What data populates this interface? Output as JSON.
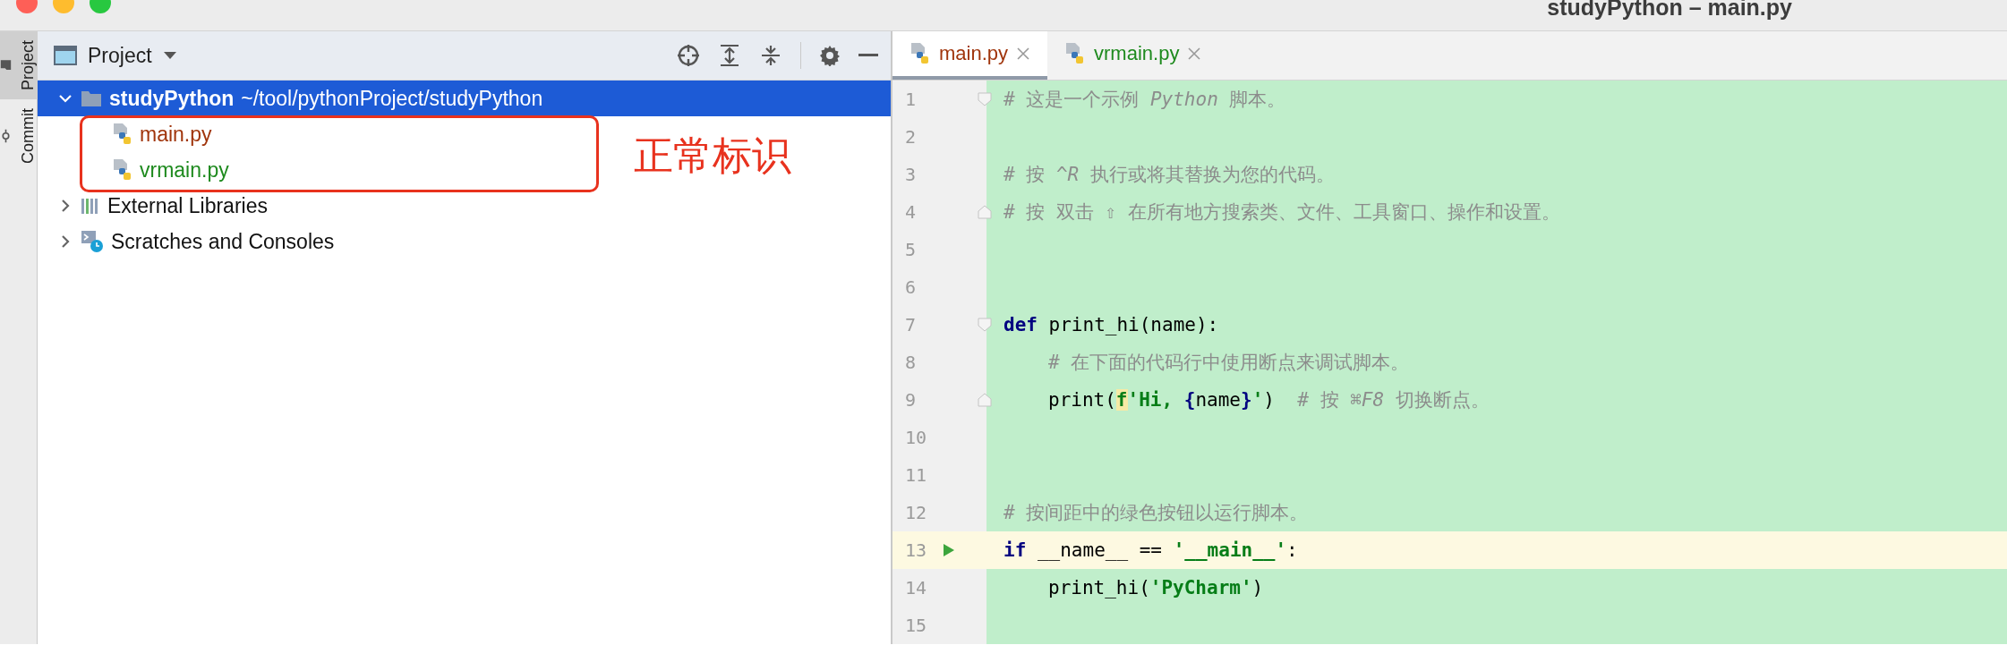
{
  "window": {
    "title": "studyPython – main.py"
  },
  "tool_strip": [
    {
      "label": "Project",
      "selected": true,
      "kind": "folder"
    },
    {
      "label": "Commit",
      "selected": false,
      "kind": "commit"
    }
  ],
  "project_panel": {
    "title": "Project",
    "tree": [
      {
        "name": "studyPython",
        "path": "~/tool/pythonProject/studyPython",
        "kind": "folder",
        "expanded": true,
        "selected": true,
        "children": [
          {
            "name": "main.py",
            "kind": "python",
            "color": "#a0350c",
            "selected": false
          },
          {
            "name": "vrmain.py",
            "kind": "python",
            "color": "#1e8a1e",
            "selected": false
          }
        ]
      },
      {
        "name": "External Libraries",
        "kind": "library",
        "expanded": false,
        "selected": false
      },
      {
        "name": "Scratches and Consoles",
        "kind": "scratch",
        "expanded": false,
        "selected": false
      }
    ],
    "annotation": {
      "label": "正常标识"
    }
  },
  "editor": {
    "tabs": [
      {
        "label": "main.py",
        "color": "#a0350c",
        "selected": true
      },
      {
        "label": "vrmain.py",
        "color": "#1e8a1e",
        "selected": false
      }
    ],
    "lines": [
      {
        "number": "1",
        "fold_open": true,
        "fold_close": false,
        "indented": false,
        "run": false,
        "current": false,
        "tokens": [
          {
            "kind": "comment",
            "text": "# 这是一个示例 "
          },
          {
            "kind": "comment-italic",
            "text": "Python"
          },
          {
            "kind": "comment",
            "text": " 脚本。"
          }
        ]
      },
      {
        "number": "2",
        "fold_open": false,
        "fold_close": false,
        "run": false,
        "current": false
      },
      {
        "number": "3",
        "fold_open": false,
        "fold_close": false,
        "indented": false,
        "run": false,
        "current": false,
        "tokens": [
          {
            "kind": "comment",
            "text": "# 按 "
          },
          {
            "kind": "comment-italic",
            "text": "^R"
          },
          {
            "kind": "comment",
            "text": " 执行或将其替换为您的代码。"
          }
        ]
      },
      {
        "number": "4",
        "fold_open": false,
        "fold_close": true,
        "indented": false,
        "run": false,
        "current": false,
        "tokens": [
          {
            "kind": "comment",
            "text": "# 按 双击 ⇧ 在所有地方搜索类、文件、工具窗口、操作和设置。"
          }
        ]
      },
      {
        "number": "5",
        "fold_open": false,
        "fold_close": false,
        "run": false,
        "current": false
      },
      {
        "number": "6",
        "fold_open": false,
        "fold_close": false,
        "run": false,
        "current": false
      },
      {
        "number": "7",
        "fold_open": true,
        "fold_close": false,
        "indented": false,
        "run": false,
        "current": false,
        "tokens": [
          {
            "kind": "keyword",
            "text": "def"
          },
          {
            "kind": "plain",
            "text": " print_hi(name):"
          }
        ]
      },
      {
        "number": "8",
        "fold_open": false,
        "fold_close": false,
        "indented": true,
        "run": false,
        "current": false,
        "tokens": [
          {
            "kind": "comment",
            "text": "# 在下面的代码行中使用断点来调试脚本。"
          }
        ]
      },
      {
        "number": "9",
        "fold_open": false,
        "fold_close": true,
        "indented": true,
        "run": false,
        "current": false,
        "tokens": [
          {
            "kind": "plain",
            "text": "print("
          },
          {
            "kind": "fprefix",
            "text": "f"
          },
          {
            "kind": "string",
            "text": "'Hi, "
          },
          {
            "kind": "brace",
            "text": "{"
          },
          {
            "kind": "plain",
            "text": "name"
          },
          {
            "kind": "brace",
            "text": "}"
          },
          {
            "kind": "string",
            "text": "'"
          },
          {
            "kind": "plain",
            "text": ")  "
          },
          {
            "kind": "comment",
            "text": "# 按 "
          },
          {
            "kind": "comment-italic",
            "text": "⌘F8"
          },
          {
            "kind": "comment",
            "text": " 切换断点。"
          }
        ]
      },
      {
        "number": "10",
        "fold_open": false,
        "fold_close": false,
        "run": false,
        "current": false
      },
      {
        "number": "11",
        "fold_open": false,
        "fold_close": false,
        "run": false,
        "current": false
      },
      {
        "number": "12",
        "fold_open": false,
        "fold_close": false,
        "indented": false,
        "run": false,
        "current": false,
        "tokens": [
          {
            "kind": "comment",
            "text": "# 按间距中的绿色按钮以运行脚本。"
          }
        ]
      },
      {
        "number": "13",
        "fold_open": false,
        "fold_close": false,
        "indented": false,
        "run": true,
        "current": true,
        "tokens": [
          {
            "kind": "keyword",
            "text": "if"
          },
          {
            "kind": "plain",
            "text": " __name__ == "
          },
          {
            "kind": "string",
            "text": "'__main__'"
          },
          {
            "kind": "plain",
            "text": ":"
          }
        ]
      },
      {
        "number": "14",
        "fold_open": false,
        "fold_close": false,
        "indented": true,
        "run": false,
        "current": false,
        "tokens": [
          {
            "kind": "plain",
            "text": "print_hi("
          },
          {
            "kind": "string",
            "text": "'PyCharm'"
          },
          {
            "kind": "plain",
            "text": ")"
          }
        ]
      },
      {
        "number": "15",
        "fold_open": false,
        "fold_close": false,
        "run": false,
        "current": false
      }
    ]
  }
}
